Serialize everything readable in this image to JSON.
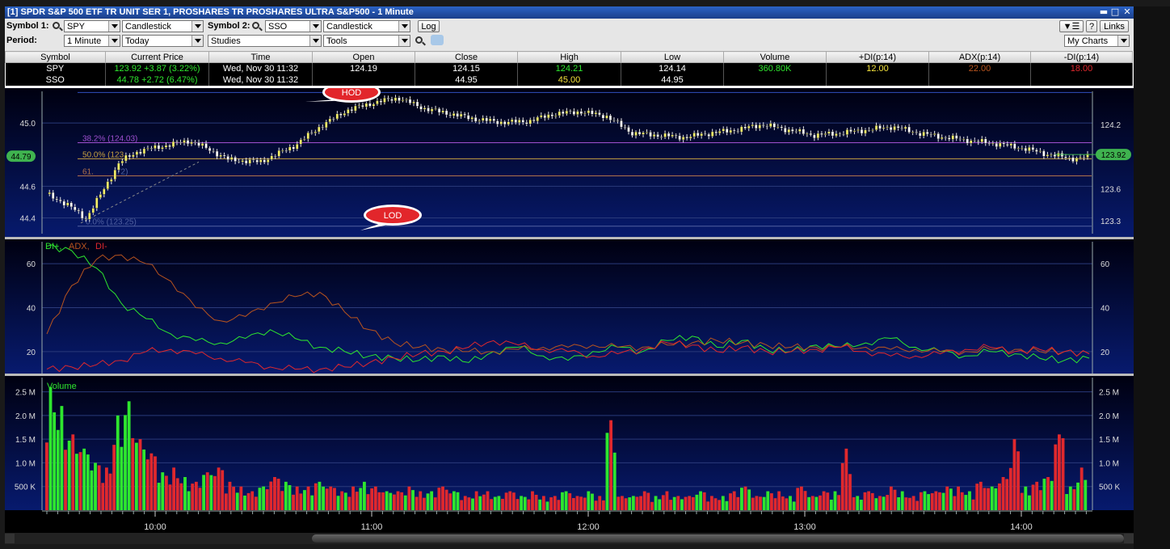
{
  "window": {
    "title": "[1] SPDR S&P 500 ETF TR UNIT SER 1, PROSHARES TR PROSHARES ULTRA S&P500 - 1 Minute"
  },
  "toolbar": {
    "symbol1_label": "Symbol 1:",
    "symbol1_value": "SPY",
    "chart_type1": "Candlestick",
    "symbol2_label": "Symbol 2:",
    "symbol2_value": "SSO",
    "chart_type2": "Candlestick",
    "log_label": "Log",
    "period_label": "Period:",
    "period_value": "1 Minute",
    "range_value": "Today",
    "studies_value": "Studies",
    "tools_value": "Tools",
    "help_label": "?",
    "links_label": "Links",
    "mycharts_value": "My Charts"
  },
  "quote_table": {
    "columns": [
      "Symbol",
      "Current Price",
      "Time",
      "Open",
      "Close",
      "High",
      "Low",
      "Volume",
      "+DI(p:14)",
      "ADX(p:14)",
      "-DI(p:14)"
    ],
    "rows": [
      {
        "symbol": "SPY",
        "price": "123.92  +3.87 (3.22%)",
        "time": "Wed, Nov 30  11:32",
        "open": "124.19",
        "close": "124.15",
        "high": "124.21",
        "low": "124.14",
        "volume": "360.80K",
        "pdi": "12.00",
        "adx": "22.00",
        "mdi": "18.00"
      },
      {
        "symbol": "SSO",
        "price": "44.78  +2.72 (6.47%)",
        "time": "Wed, Nov 30  11:32",
        "open": "",
        "close": "44.95",
        "high": "45.00",
        "low": "44.95",
        "volume": "",
        "pdi": "",
        "adx": "",
        "mdi": ""
      }
    ]
  },
  "colors": {
    "background": "#04083a",
    "up": "#2ee62e",
    "down": "#e0282d",
    "candle": "#f5f06a",
    "adx": "#b8541e",
    "price_tag": "#3fb34f"
  },
  "chart_data": [
    {
      "type": "candlestick",
      "panel": "price",
      "x_ticks": [
        "10:00",
        "11:00",
        "12:00",
        "13:00",
        "14:00"
      ],
      "left_axis_ticks": [
        "45.0",
        "44.6",
        "44.4"
      ],
      "right_axis_ticks": [
        "124.2",
        "123.6",
        "123.3"
      ],
      "left_ylim": [
        44.3,
        45.2
      ],
      "right_ylim": [
        123.18,
        124.51
      ],
      "current_left": "44.79",
      "current_right": "123.92",
      "fib_labels": [
        "38.2% (124.03)",
        "50.0% (123.",
        "61.",
        "72)",
        "0.0% (123.25)"
      ],
      "fib_values": [
        124.03,
        123.88,
        123.72,
        123.25
      ],
      "high_line": 124.5,
      "callouts": [
        "HOD",
        "LOD"
      ],
      "spy_path": [
        [
          0,
          123.55
        ],
        [
          8,
          123.45
        ],
        [
          15,
          123.32
        ],
        [
          22,
          123.6
        ],
        [
          28,
          123.85
        ],
        [
          35,
          123.95
        ],
        [
          45,
          124.0
        ],
        [
          55,
          124.05
        ],
        [
          62,
          123.97
        ],
        [
          70,
          123.87
        ],
        [
          82,
          123.85
        ],
        [
          95,
          124.0
        ],
        [
          105,
          124.18
        ],
        [
          115,
          124.33
        ],
        [
          125,
          124.4
        ],
        [
          135,
          124.45
        ],
        [
          145,
          124.35
        ],
        [
          155,
          124.3
        ],
        [
          165,
          124.25
        ],
        [
          175,
          124.22
        ],
        [
          185,
          124.23
        ],
        [
          195,
          124.3
        ],
        [
          205,
          124.32
        ],
        [
          215,
          124.28
        ],
        [
          225,
          124.12
        ],
        [
          235,
          124.1
        ],
        [
          245,
          124.08
        ],
        [
          255,
          124.12
        ],
        [
          265,
          124.15
        ],
        [
          275,
          124.2
        ],
        [
          285,
          124.15
        ],
        [
          295,
          124.1
        ],
        [
          305,
          124.12
        ],
        [
          315,
          124.15
        ],
        [
          325,
          124.18
        ],
        [
          335,
          124.12
        ],
        [
          345,
          124.08
        ],
        [
          355,
          124.05
        ],
        [
          365,
          124.02
        ],
        [
          375,
          123.98
        ],
        [
          385,
          123.92
        ],
        [
          395,
          123.88
        ],
        [
          405,
          123.92
        ]
      ]
    },
    {
      "type": "line",
      "panel": "indicator",
      "y_ticks": [
        "60",
        "40",
        "20"
      ],
      "ylim": [
        10,
        70
      ],
      "series": [
        {
          "name": "DI+",
          "color": "#2ee62e",
          "values": [
            68,
            66,
            58,
            42,
            35,
            28,
            25,
            24,
            26,
            30,
            26,
            22,
            20,
            18,
            17,
            16,
            18,
            15,
            20,
            22,
            18,
            16,
            20,
            22,
            20,
            25,
            27,
            22,
            25,
            21,
            20,
            23,
            22,
            24,
            26,
            22,
            20,
            18,
            20,
            19,
            17,
            16,
            17
          ]
        },
        {
          "name": "ADX",
          "color": "#b8541e",
          "values": [
            28,
            50,
            62,
            64,
            60,
            52,
            40,
            34,
            36,
            42,
            45,
            47,
            38,
            30,
            24,
            22,
            21,
            20,
            20,
            21,
            22,
            22,
            23,
            22,
            22,
            23,
            24,
            25,
            24,
            23,
            22,
            22,
            22,
            22,
            21,
            21,
            20,
            20,
            21,
            21,
            20,
            20,
            19
          ]
        },
        {
          "name": "DI-",
          "color": "#e0282d",
          "values": [
            12,
            13,
            14,
            16,
            20,
            21,
            19,
            17,
            15,
            13,
            12,
            12,
            13,
            15,
            17,
            19,
            20,
            22,
            25,
            23,
            21,
            20,
            18,
            19,
            21,
            24,
            23,
            20,
            22,
            20,
            20,
            21,
            22,
            20,
            18,
            18,
            19,
            21,
            22,
            20,
            21,
            20,
            19
          ]
        }
      ]
    },
    {
      "type": "bar",
      "panel": "volume",
      "title": "Volume",
      "y_ticks": [
        "2.5 M",
        "2.0 M",
        "1.5 M",
        "1.0 M",
        "500 K"
      ],
      "ylim": [
        0,
        2.8
      ],
      "values_millions": [
        2.6,
        2.2,
        1.6,
        1.3,
        1.0,
        0.9,
        2.0,
        2.3,
        1.5,
        1.2,
        0.8,
        0.9,
        0.7,
        0.6,
        0.8,
        0.9,
        0.6,
        0.5,
        0.4,
        0.5,
        0.7,
        0.6,
        0.5,
        0.5,
        0.6,
        0.5,
        0.4,
        0.5,
        0.6,
        0.5,
        0.4,
        0.4,
        0.5,
        0.4,
        0.4,
        0.5,
        0.4,
        0.3,
        0.4,
        0.4,
        0.3,
        0.4,
        0.3,
        0.4,
        0.3,
        0.3,
        0.4,
        0.3,
        0.4,
        0.3,
        1.9,
        0.3,
        0.3,
        0.4,
        0.3,
        0.4,
        0.3,
        0.3,
        0.4,
        0.3,
        0.3,
        0.4,
        0.5,
        0.3,
        0.4,
        0.4,
        0.3,
        0.5,
        0.3,
        0.4,
        0.4,
        1.3,
        0.3,
        0.4,
        0.3,
        0.5,
        0.4,
        0.3,
        0.4,
        0.4,
        0.5,
        0.5,
        0.4,
        0.6,
        0.5,
        0.7,
        1.5,
        0.5,
        0.6,
        0.7,
        1.6,
        0.5,
        0.9
      ],
      "colors": [
        "g",
        "g",
        "g",
        "g",
        "g",
        "r",
        "g",
        "g",
        "g",
        "r",
        "g",
        "r",
        "g",
        "r",
        "g",
        "r",
        "r",
        "g",
        "r",
        "g",
        "r",
        "g",
        "r",
        "g",
        "g",
        "r",
        "g",
        "r",
        "g",
        "r",
        "g",
        "r",
        "g",
        "r",
        "g",
        "r",
        "g",
        "r",
        "g",
        "r",
        "g",
        "r",
        "g",
        "r",
        "g",
        "r",
        "g",
        "r",
        "g",
        "r",
        "g",
        "r",
        "g",
        "r",
        "g",
        "r",
        "g",
        "r",
        "g",
        "r",
        "g",
        "r",
        "g",
        "r",
        "g",
        "r",
        "g",
        "r",
        "g",
        "r",
        "g",
        "r",
        "g",
        "r",
        "g",
        "r",
        "g",
        "r",
        "g",
        "r",
        "g",
        "r",
        "g",
        "r",
        "g",
        "r",
        "r",
        "g",
        "r",
        "g",
        "r",
        "g",
        "g"
      ]
    }
  ]
}
